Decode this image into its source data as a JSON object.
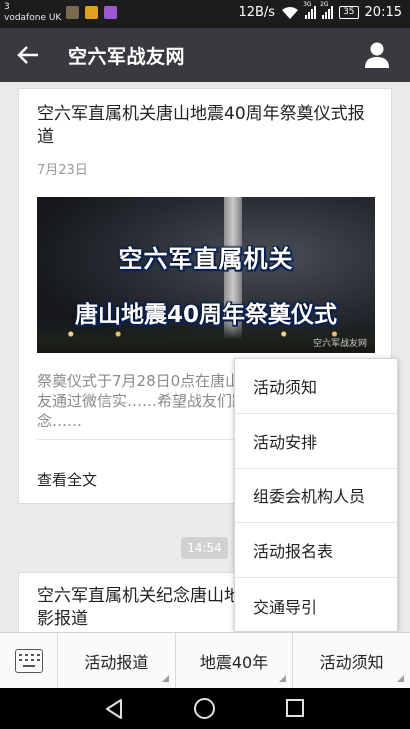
{
  "status_bar": {
    "carrier_line1": "3",
    "carrier_line2": "vodafone UK",
    "network_speed": "12B/s",
    "signal1_label": "3G",
    "signal2_label": "2G",
    "battery": "35",
    "time": "20:15",
    "colors": {
      "app1": "#7a6a52",
      "app2": "#e0a020",
      "app3": "#9a5ad0"
    }
  },
  "header": {
    "title": "空六军战友网",
    "back_icon": "back-arrow-icon",
    "profile_icon": "person-icon"
  },
  "articles": [
    {
      "title": "空六军直属机关唐山地震40周年祭奠仪式报道",
      "date": "7月23日",
      "image_line1": "空六军直属机关",
      "image_line2": "唐山地震40周年祭奠仪式",
      "watermark": "空六军战友网",
      "summary": "祭奠仪式于7月28日0点在唐山……行。现在征集战友通过微信实……希望战友们踊跃参加，为纪念……",
      "read_more": "查看全文"
    },
    {
      "title": "空六军直属机关纪念唐山地震40周年集体合影报道"
    }
  ],
  "time_divider": "14:54",
  "popup_menu": {
    "items": [
      "活动须知",
      "活动安排",
      "组委会机构人员",
      "活动报名表",
      "交通导引"
    ]
  },
  "bottom_menu": {
    "keyboard_icon": "keyboard-icon",
    "tabs": [
      "活动报道",
      "地震40年",
      "活动须知"
    ]
  },
  "colors": {
    "title_bar": "#393a3f",
    "status_bar": "#1c1c1c",
    "background": "#ebebeb"
  }
}
